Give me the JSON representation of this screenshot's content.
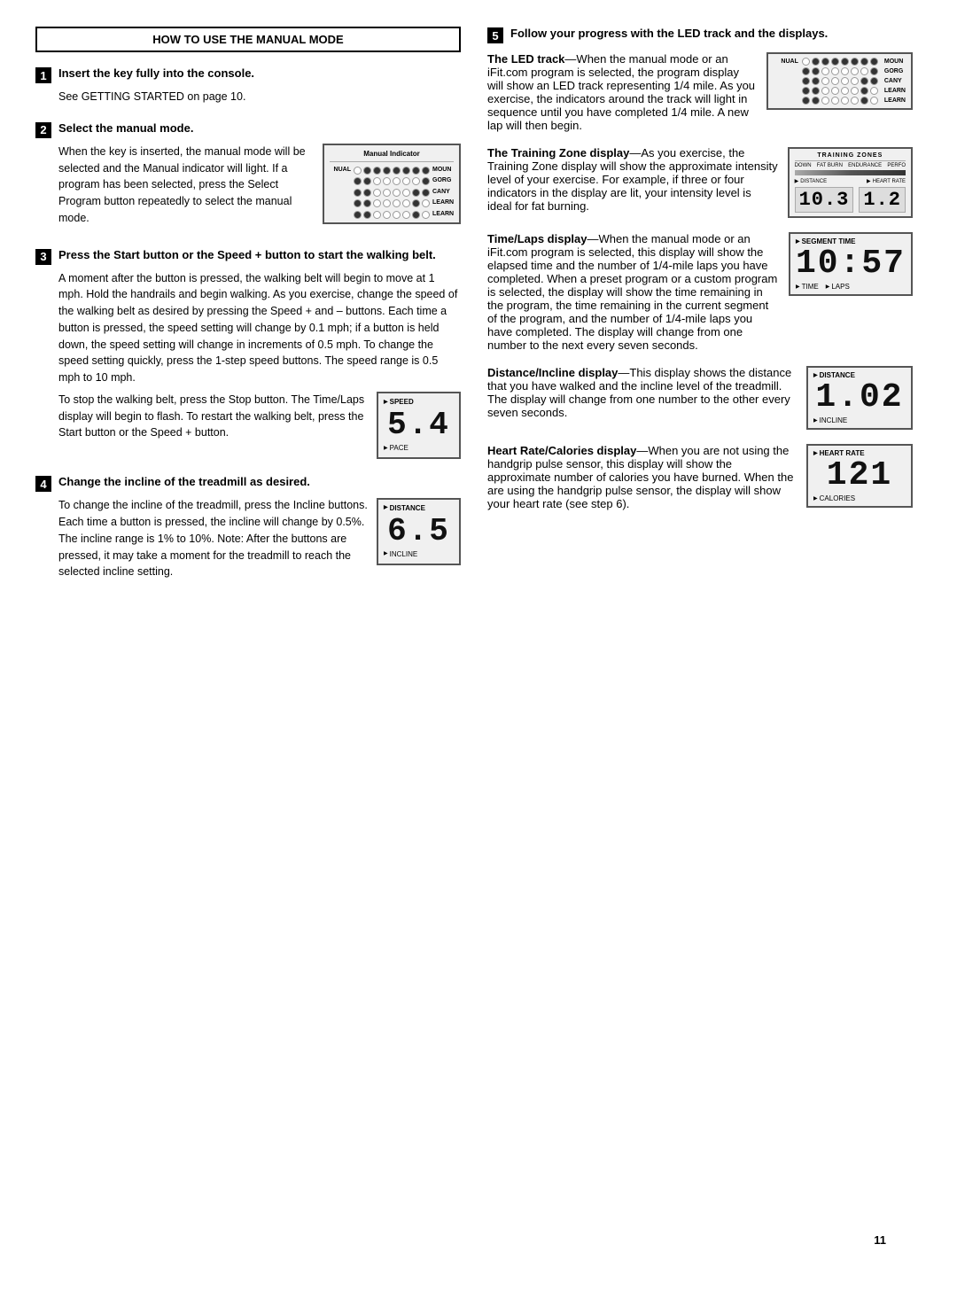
{
  "header": {
    "title": "HOW TO USE THE MANUAL MODE"
  },
  "left_column": {
    "steps": [
      {
        "number": "1",
        "title": "Insert the key fully into the console.",
        "body": [
          "See GETTING STARTED on page 10."
        ]
      },
      {
        "number": "2",
        "title": "Select the manual mode.",
        "body": [
          "When the key is inserted, the manual mode will be selected and the Manual indicator will light. If a program has been selected, press the Select Program button repeatedly to select the manual mode."
        ],
        "has_figure": true,
        "figure_label": "Manual Indicator"
      },
      {
        "number": "3",
        "title": "Press the Start button or the Speed + button to start the walking belt.",
        "body": [
          "A moment after the button is pressed, the walking belt will begin to move at 1 mph. Hold the handrails and begin walking. As you exercise, change the speed of the walking belt as desired by pressing the Speed + and – buttons. Each time a button is pressed, the speed setting will change by 0.1 mph; if a button is held down, the speed setting will change in increments of 0.5 mph. To change the speed setting quickly, press the 1-step speed buttons. The speed range is 0.5 mph to 10 mph.",
          "To stop the walking belt, press the Stop button. The Time/Laps display will begin to flash. To restart the walking belt, press the Start button or the Speed + button."
        ],
        "has_figure": true,
        "figure_speed": "5.4"
      },
      {
        "number": "4",
        "title": "Change the incline of the treadmill as desired.",
        "body": [
          "To change the incline of the treadmill, press the Incline buttons. Each time a button is pressed, the incline will change by 0.5%. The incline range is 1% to 10%. Note: After the buttons are pressed, it may take a moment for the treadmill to reach the selected incline setting."
        ],
        "has_figure": true,
        "figure_distance": "6.5"
      }
    ]
  },
  "right_column": {
    "step5": {
      "number": "5",
      "title": "Follow your progress with the LED track and the displays."
    },
    "sections": [
      {
        "id": "led-track",
        "title": "The LED track",
        "title_suffix": "—When the manual mode or an iFit.com program is selected, the program display will show an LED track representing 1/4 mile. As you exercise, the indicators around the track will light in sequence until you have completed 1/4 mile. A new lap will then begin."
      },
      {
        "id": "training-zone",
        "title": "The Training Zone display",
        "title_suffix": "—As you exercise, the Training Zone display will show the approximate intensity level of your exercise. For example, if three or four indicators in the display are lit, your intensity level is ideal for fat burning.",
        "tz_zones": [
          "DOWN",
          "FAT BURN",
          "ENDURANCE",
          "PERFO"
        ],
        "tz_bottom_labels": [
          "DISTANCE",
          "HEART RATE"
        ],
        "tz_numbers": [
          "10.3",
          "1.2"
        ]
      },
      {
        "id": "time-laps",
        "title": "Time/Laps display",
        "title_suffix": "—When the manual mode or an iFit.com program is selected, this display will show the elapsed time and the number of 1/4-mile laps you have completed. When a preset program or a custom program is selected, the display will show the time remaining in the program, the time remaining in the current segment of the program, and the number of 1/4-mile laps you have completed. The display will change from one number to the next every seven seconds.",
        "display_top": "SEGMENT TIME",
        "display_number": "10:57",
        "display_bottom_labels": [
          "TIME",
          "LAPS"
        ]
      },
      {
        "id": "distance-incline",
        "title": "Distance/Incline display",
        "title_suffix": "—This display shows the distance that you have walked and the incline level of the treadmill. The display will change from one number to the other every seven seconds.",
        "display_top": "DISTANCE",
        "display_number": "1.02",
        "display_bottom_label": "INCLINE"
      },
      {
        "id": "heart-rate",
        "title": "Heart Rate/Calories display",
        "title_suffix": "—When you are not using the handgrip pulse sensor, this display will show the approximate number of calories you have burned. When the are using the handgrip pulse sensor, the display will show your heart rate (see step 6).",
        "display_top": "HEART RATE",
        "display_number": "121",
        "display_bottom_label": "CALORIES"
      }
    ]
  },
  "page_number": "11",
  "led_rows": [
    {
      "label": "NUAL",
      "dots": [
        false,
        true,
        true,
        true,
        true,
        true,
        true,
        true
      ],
      "side_label": "MOUN"
    },
    {
      "label": "",
      "dots": [
        true,
        true,
        false,
        false,
        false,
        false,
        false,
        true
      ],
      "side_label": "GORG"
    },
    {
      "label": "",
      "dots": [
        true,
        true,
        false,
        false,
        false,
        false,
        true,
        true
      ],
      "side_label": "CANY"
    },
    {
      "label": "",
      "dots": [
        true,
        true,
        false,
        false,
        false,
        false,
        true,
        false
      ],
      "side_label": "LEARN"
    },
    {
      "label": "",
      "dots": [
        true,
        true,
        false,
        false,
        false,
        false,
        true,
        false
      ],
      "side_label": "LEARN"
    }
  ],
  "manual_indicator_rows": [
    {
      "label": "NUAL",
      "dots": [
        false,
        true,
        true,
        true,
        true,
        true,
        true,
        true
      ],
      "side_label": "MOUN"
    },
    {
      "label": "",
      "dots": [
        true,
        true,
        false,
        false,
        false,
        false,
        false,
        true
      ],
      "side_label": "GORG"
    },
    {
      "label": "",
      "dots": [
        true,
        true,
        false,
        false,
        false,
        false,
        true,
        true
      ],
      "side_label": "CANY"
    },
    {
      "label": "",
      "dots": [
        true,
        true,
        false,
        false,
        false,
        false,
        true,
        false
      ],
      "side_label": "LEARN"
    },
    {
      "label": "",
      "dots": [
        true,
        true,
        false,
        false,
        false,
        false,
        true,
        false
      ],
      "side_label": "LEARN"
    }
  ]
}
